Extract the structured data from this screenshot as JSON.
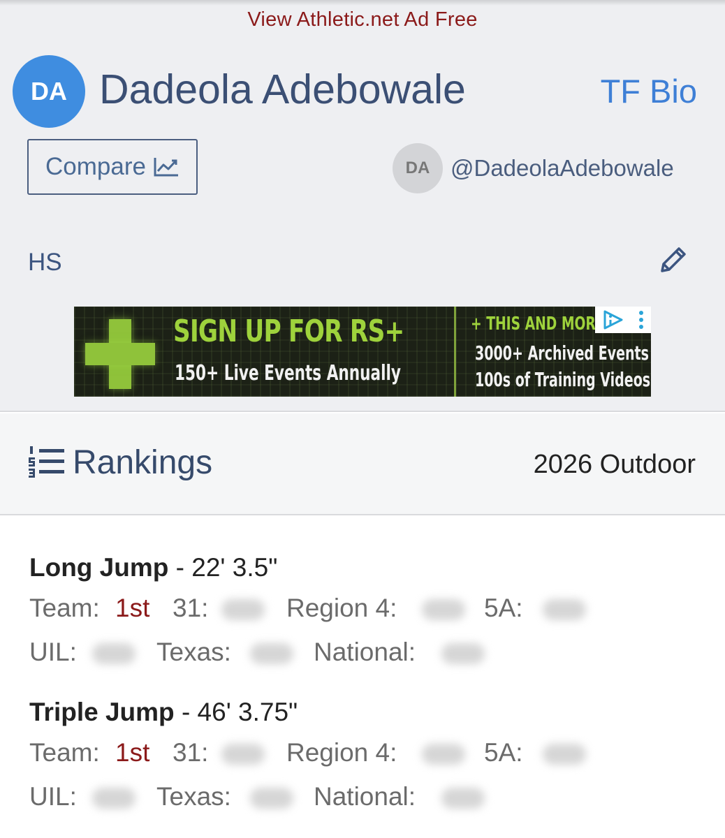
{
  "promo": {
    "ad_free_text": "View Athletic.net Ad Free"
  },
  "athlete": {
    "initials": "DA",
    "name": "Dadeola Adebowale",
    "bio_link": "TF Bio",
    "compare_label": "Compare",
    "handle_initials": "DA",
    "handle": "@DadeolaAdebowale",
    "level": "HS"
  },
  "ad": {
    "headline": "SIGN UP FOR RS+",
    "subline": "150+ Live Events Annually",
    "right_head": "+ THIS AND MORE",
    "right_line1": "3000+ Archived Events",
    "right_line2": "100s of Training Videos"
  },
  "rankings": {
    "title": "Rankings",
    "season": "2026 Outdoor",
    "events": [
      {
        "name": "Long Jump",
        "mark": "- 22' 3.5\"",
        "team_label": "Team:",
        "team_place": "1st",
        "district_label": "31:",
        "region_label": "Region 4:",
        "class_label": "5A:",
        "uil_label": "UIL:",
        "state_label": "Texas:",
        "national_label": "National:"
      },
      {
        "name": "Triple Jump",
        "mark": "- 46' 3.75\"",
        "team_label": "Team:",
        "team_place": "1st",
        "district_label": "31:",
        "region_label": "Region 4:",
        "class_label": "5A:",
        "uil_label": "UIL:",
        "state_label": "Texas:",
        "national_label": "National:"
      }
    ]
  },
  "colors": {
    "accent_blue": "#3e7fd6",
    "avatar_blue": "#3f8de0",
    "navy_text": "#3b4f74",
    "place_red": "#8b1a1a",
    "ad_green": "#9ed23c"
  },
  "icons": [
    "chart-line-icon",
    "pencil-icon",
    "list-ol-icon",
    "ad-choices-icon",
    "ad-menu-icon"
  ]
}
